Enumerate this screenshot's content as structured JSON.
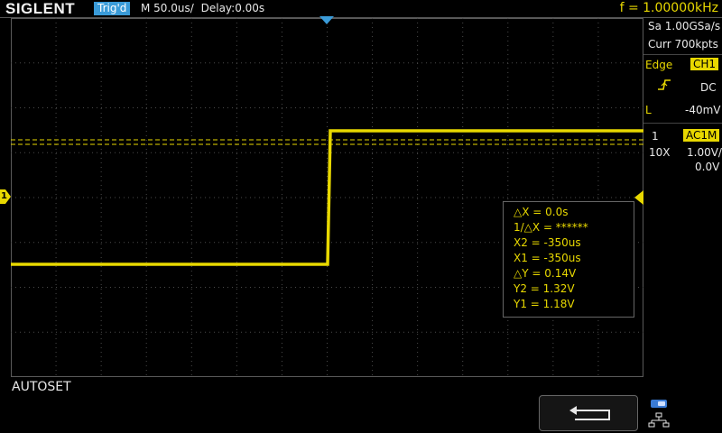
{
  "header": {
    "brand": "SIGLENT",
    "trigger_status": "Trig'd",
    "timebase": "M 50.0us/",
    "delay": "Delay:0.00s",
    "frequency": "f = 1.00000kHz"
  },
  "acquisition": {
    "sample_rate": "Sa 1.00GSa/s",
    "memory_depth": "Curr 700kpts"
  },
  "trigger": {
    "type_label": "Edge",
    "source": "CH1",
    "coupling": "DC",
    "level_label": "L",
    "level_value": "-40mV",
    "slope_icon": "rising-edge-icon"
  },
  "channel1": {
    "number": "1",
    "coupling_impedance": "AC1M",
    "probe": "10X",
    "volts_per_div": "1.00V/",
    "offset": "0.0V",
    "marker_label": "1",
    "color": "#e8d800"
  },
  "cursors": {
    "delta_x": "△X = 0.0s",
    "inv_delta_x": "1/△X = ******",
    "x2": "X2 = -350us",
    "x1": "X1 = -350us",
    "delta_y": "△Y = 0.14V",
    "y2": "Y2 = 1.32V",
    "y1": "Y1 = 1.18V"
  },
  "footer": {
    "menu_title": "AUTOSET",
    "back_icon": "return-arrow-icon",
    "network_icon": "network-icon"
  },
  "colors": {
    "trace": "#e8d800",
    "accent_blue": "#3a9bd8",
    "grid": "#4a4a4a"
  }
}
